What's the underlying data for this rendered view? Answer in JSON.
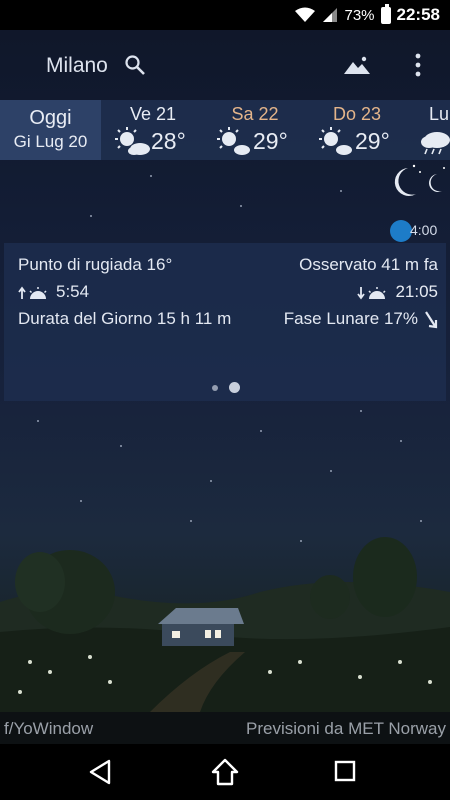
{
  "status_bar": {
    "battery_percent": "73%",
    "time": "22:58",
    "icons": [
      "wifi-icon",
      "signal-icon",
      "battery-icon"
    ]
  },
  "app_bar": {
    "city": "Milano",
    "icons": [
      "search-icon",
      "landscape-icon",
      "menu-icon"
    ]
  },
  "forecast": {
    "today": {
      "label": "Oggi",
      "date": "Gi Lug 20"
    },
    "days": [
      {
        "name": "Ve 21",
        "temp": "28°",
        "icon": "sun-cloud-icon",
        "weekend": false
      },
      {
        "name": "Sa 22",
        "temp": "29°",
        "icon": "sun-cloud-icon",
        "weekend": true
      },
      {
        "name": "Do 23",
        "temp": "29°",
        "icon": "sun-cloud-icon",
        "weekend": true
      },
      {
        "name": "Lu",
        "temp": "",
        "icon": "rain-cloud-icon",
        "weekend": false
      }
    ]
  },
  "timeline": {
    "time": "4:00"
  },
  "details": {
    "dew_point": "Punto di rugiada 16°",
    "observed": "Osservato 41 m fa",
    "sunrise": "5:54",
    "sunset": "21:05",
    "day_length": "Durata del Giorno 15 h 11 m",
    "moon_phase": "Fase Lunare 17%",
    "pager": {
      "pages": 2,
      "current": 2
    }
  },
  "credits": {
    "left": "f/YoWindow",
    "right": "Previsioni da MET Norway"
  },
  "colors": {
    "accent": "#1d7cc8",
    "weekend": "#e3b48a",
    "panel": "#1e2e50"
  }
}
